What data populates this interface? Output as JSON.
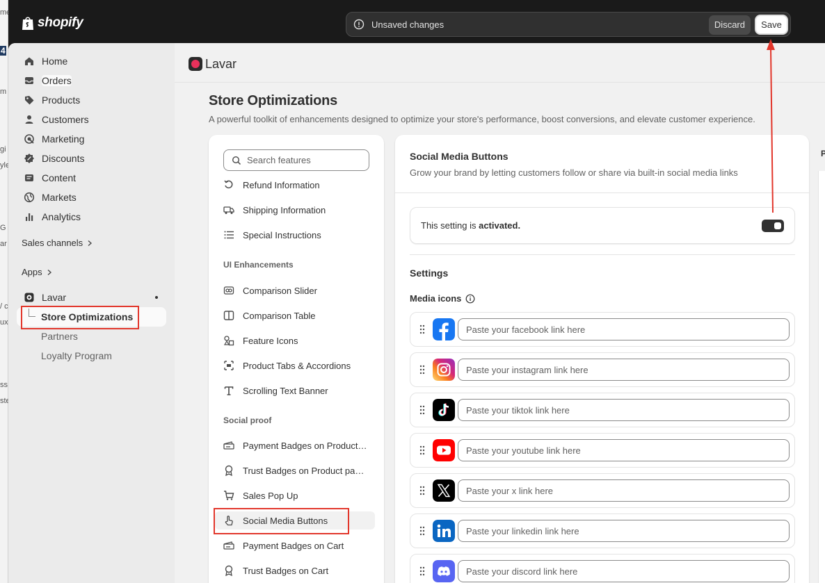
{
  "behind_window": {
    "fragments": [
      "me",
      "4",
      "m",
      "gi",
      "yle",
      "G",
      "ar",
      "/ c",
      "uxe",
      "ss",
      "ste"
    ]
  },
  "topbar": {
    "brand": "shopify",
    "unsaved_text": "Unsaved changes",
    "discard_label": "Discard",
    "save_label": "Save"
  },
  "sidebar": {
    "items": [
      {
        "label": "Home",
        "icon": "home-icon"
      },
      {
        "label": "Orders",
        "icon": "inbox-icon"
      },
      {
        "label": "Products",
        "icon": "tag-icon"
      },
      {
        "label": "Customers",
        "icon": "person-icon"
      },
      {
        "label": "Marketing",
        "icon": "target-icon"
      },
      {
        "label": "Discounts",
        "icon": "discount-icon"
      },
      {
        "label": "Content",
        "icon": "content-icon"
      },
      {
        "label": "Markets",
        "icon": "globe-icon"
      },
      {
        "label": "Analytics",
        "icon": "bar-chart-icon"
      }
    ],
    "sales_channels": "Sales channels",
    "apps": "Apps",
    "app_name": "Lavar",
    "app_subitems": [
      "Store Optimizations",
      "Partners",
      "Loyalty Program"
    ]
  },
  "main": {
    "app_name": "Lavar",
    "page_title": "Store Optimizations",
    "page_subtitle": "A powerful toolkit of enhancements designed to optimize your store's performance, boost conversions, and elevate customer experience.",
    "search_placeholder": "Search features",
    "feature_list": {
      "top_items": [
        "Refund Information",
        "Shipping Information",
        "Special Instructions"
      ],
      "ui_heading": "UI Enhancements",
      "ui_items": [
        "Comparison Slider",
        "Comparison Table",
        "Feature Icons",
        "Product Tabs & Accordions",
        "Scrolling Text Banner"
      ],
      "social_heading": "Social proof",
      "social_items": [
        "Payment Badges on Product pages",
        "Trust Badges on Product pages",
        "Sales Pop Up",
        "Social Media Buttons",
        "Payment Badges on Cart",
        "Trust Badges on Cart"
      ]
    },
    "detail": {
      "title": "Social Media Buttons",
      "subtitle": "Grow your brand by letting customers follow or share via built-in social media links",
      "status_prefix": "This setting is ",
      "status_value": "activated.",
      "settings_heading": "Settings",
      "media_icons_label": "Media icons",
      "media": [
        {
          "name": "facebook",
          "placeholder": "Paste your facebook link here",
          "color": "#1877f2"
        },
        {
          "name": "instagram",
          "placeholder": "Paste your instagram link here",
          "color": "#e1306c"
        },
        {
          "name": "tiktok",
          "placeholder": "Paste your tiktok link here",
          "color": "#000000"
        },
        {
          "name": "youtube",
          "placeholder": "Paste your youtube link here",
          "color": "#ff0000"
        },
        {
          "name": "x",
          "placeholder": "Paste your x link here",
          "color": "#000000"
        },
        {
          "name": "linkedin",
          "placeholder": "Paste your linkedin link here",
          "color": "#0a66c2"
        },
        {
          "name": "discord",
          "placeholder": "Paste your discord link here",
          "color": "#5865f2"
        }
      ]
    },
    "right_panel_letter": "P"
  },
  "colors": {
    "annotation_red": "#e2362b",
    "topbar_bg": "#1a1a1a",
    "page_bg": "#f1f1f1"
  }
}
